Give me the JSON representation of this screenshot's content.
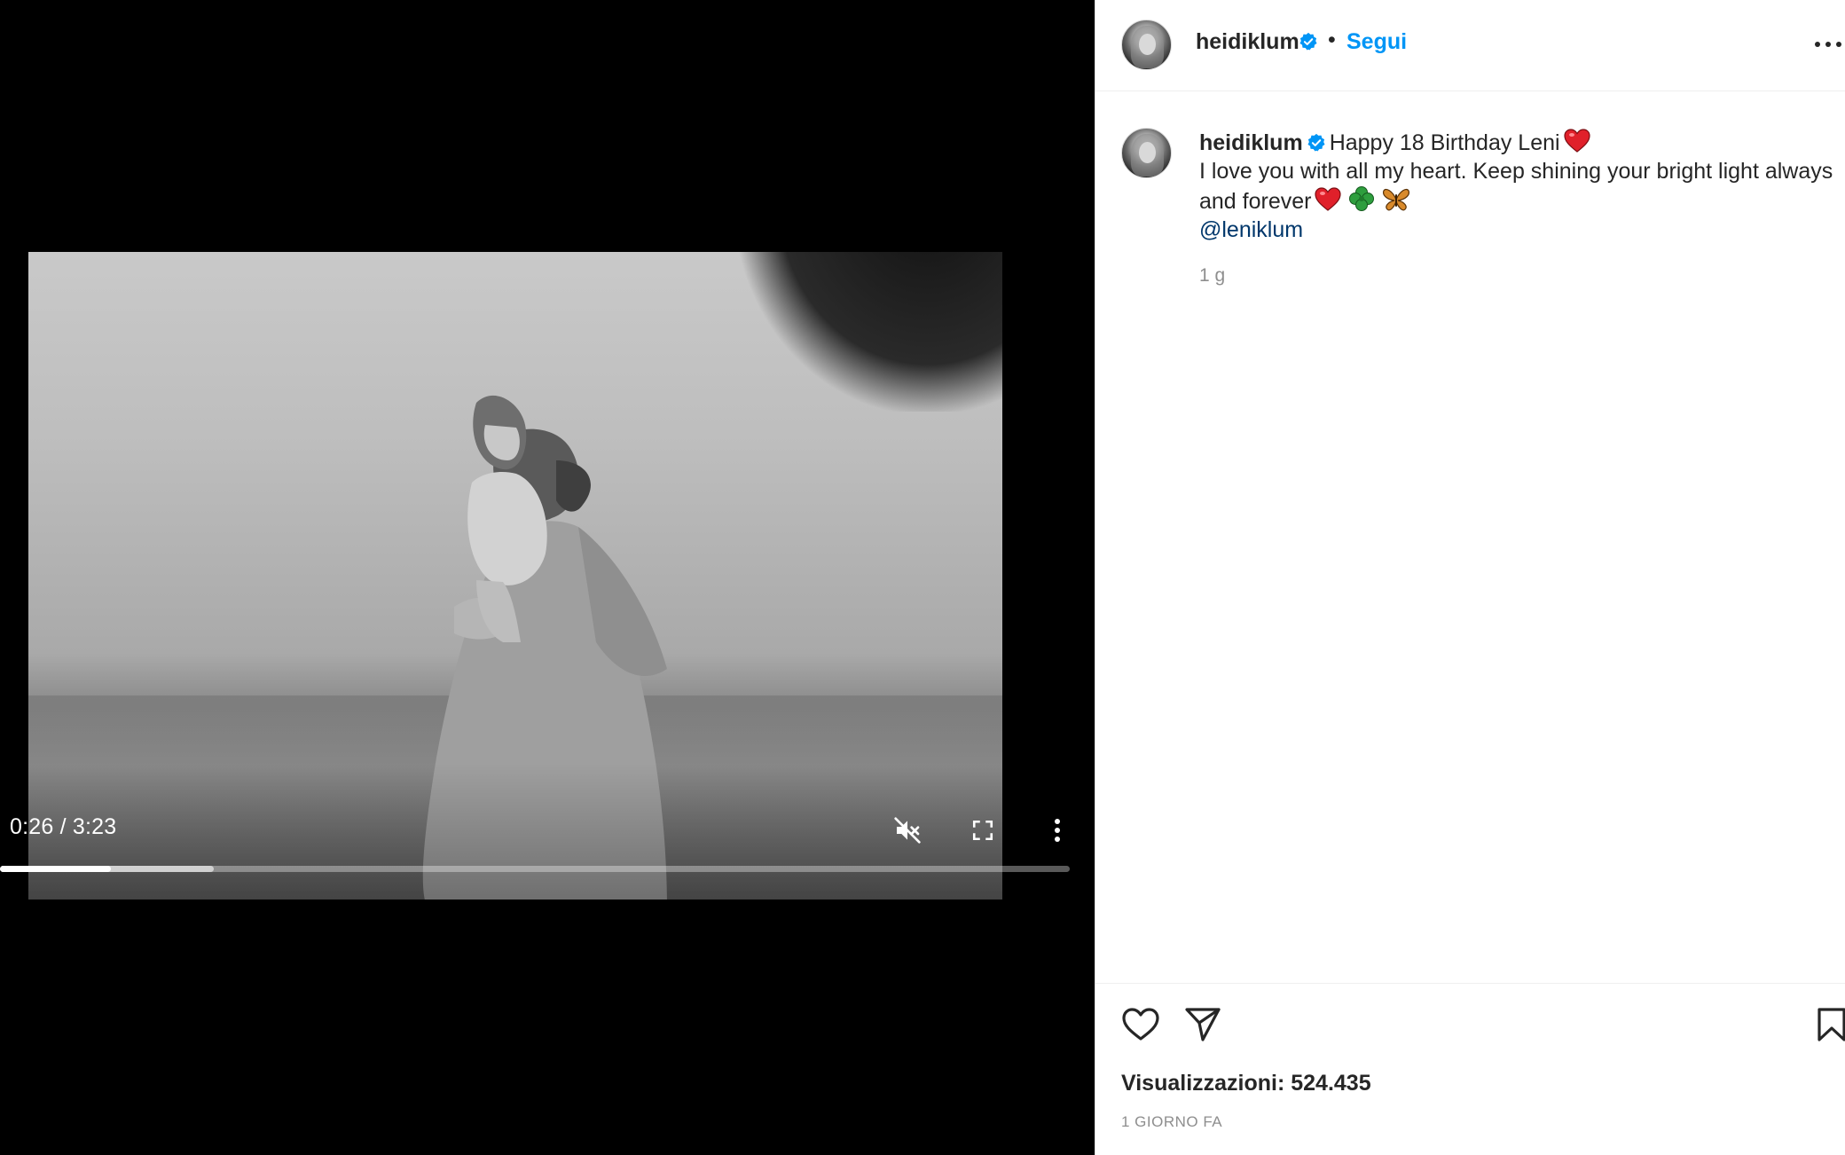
{
  "video": {
    "current_time": "0:26",
    "duration": "3:23",
    "time_display": "0:26 / 3:23",
    "played_fraction": 0.104,
    "buffered_fraction": 0.2,
    "muted": true
  },
  "post": {
    "author": {
      "username": "heidiklum",
      "verified": true
    },
    "follow_label": "Segui",
    "separator": "•",
    "caption": {
      "username": "heidiklum",
      "line1": "Happy 18 Birthday Leni",
      "line2": "I love you with all my heart. Keep shining your bright light always and forever",
      "mention": "@leniklum"
    },
    "caption_time": "1 g",
    "views_text": "Visualizzazioni: 524.435",
    "date": "1 GIORNO FA"
  },
  "icons": [
    "verified-badge-icon",
    "more-options-icon",
    "heart-emoji-icon",
    "clover-emoji-icon",
    "butterfly-emoji-icon",
    "mute-icon",
    "fullscreen-icon",
    "more-vertical-icon",
    "heart-icon",
    "share-icon",
    "bookmark-icon"
  ],
  "colors": {
    "link_blue": "#0095f6",
    "mention_blue": "#00376b",
    "verified_blue": "#0095f6",
    "secondary_text": "#8e8e8e",
    "emoji_red": "#e0202a",
    "emoji_green": "#2e9e3e",
    "emoji_orange": "#d98a2b"
  }
}
